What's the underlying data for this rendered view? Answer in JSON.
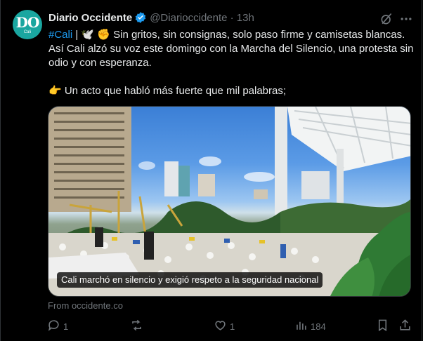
{
  "post": {
    "author_name": "Diario Occidente",
    "handle_time": "@Diarioccidente · 13h",
    "avatar_monogram": "DO",
    "avatar_sub": "Cali",
    "hashtag": "#Cali",
    "line1_rest": " | 🕊️ ✊ Sin gritos, sin consignas, solo paso firme y camisetas blancas. Así Cali alzó su voz este domingo con la Marcha del Silencio, una protesta sin odio y con esperanza.",
    "line2": "👉 Un acto que habló más fuerte que mil palabras;",
    "media_caption": "Cali marchó en silencio y exigió respeto a la seguridad nacional",
    "link_source": "From occidente.co"
  },
  "actions": {
    "replies": "1",
    "reposts": "",
    "likes": "1",
    "views": "184"
  },
  "colors": {
    "accent": "#1d9bf0",
    "muted": "#71767b",
    "text": "#e7e9ea",
    "background": "#000000"
  },
  "icons": [
    "verified-icon",
    "grok-icon",
    "more-icon",
    "reply-icon",
    "repost-icon",
    "like-icon",
    "views-icon",
    "bookmark-icon",
    "share-icon"
  ]
}
